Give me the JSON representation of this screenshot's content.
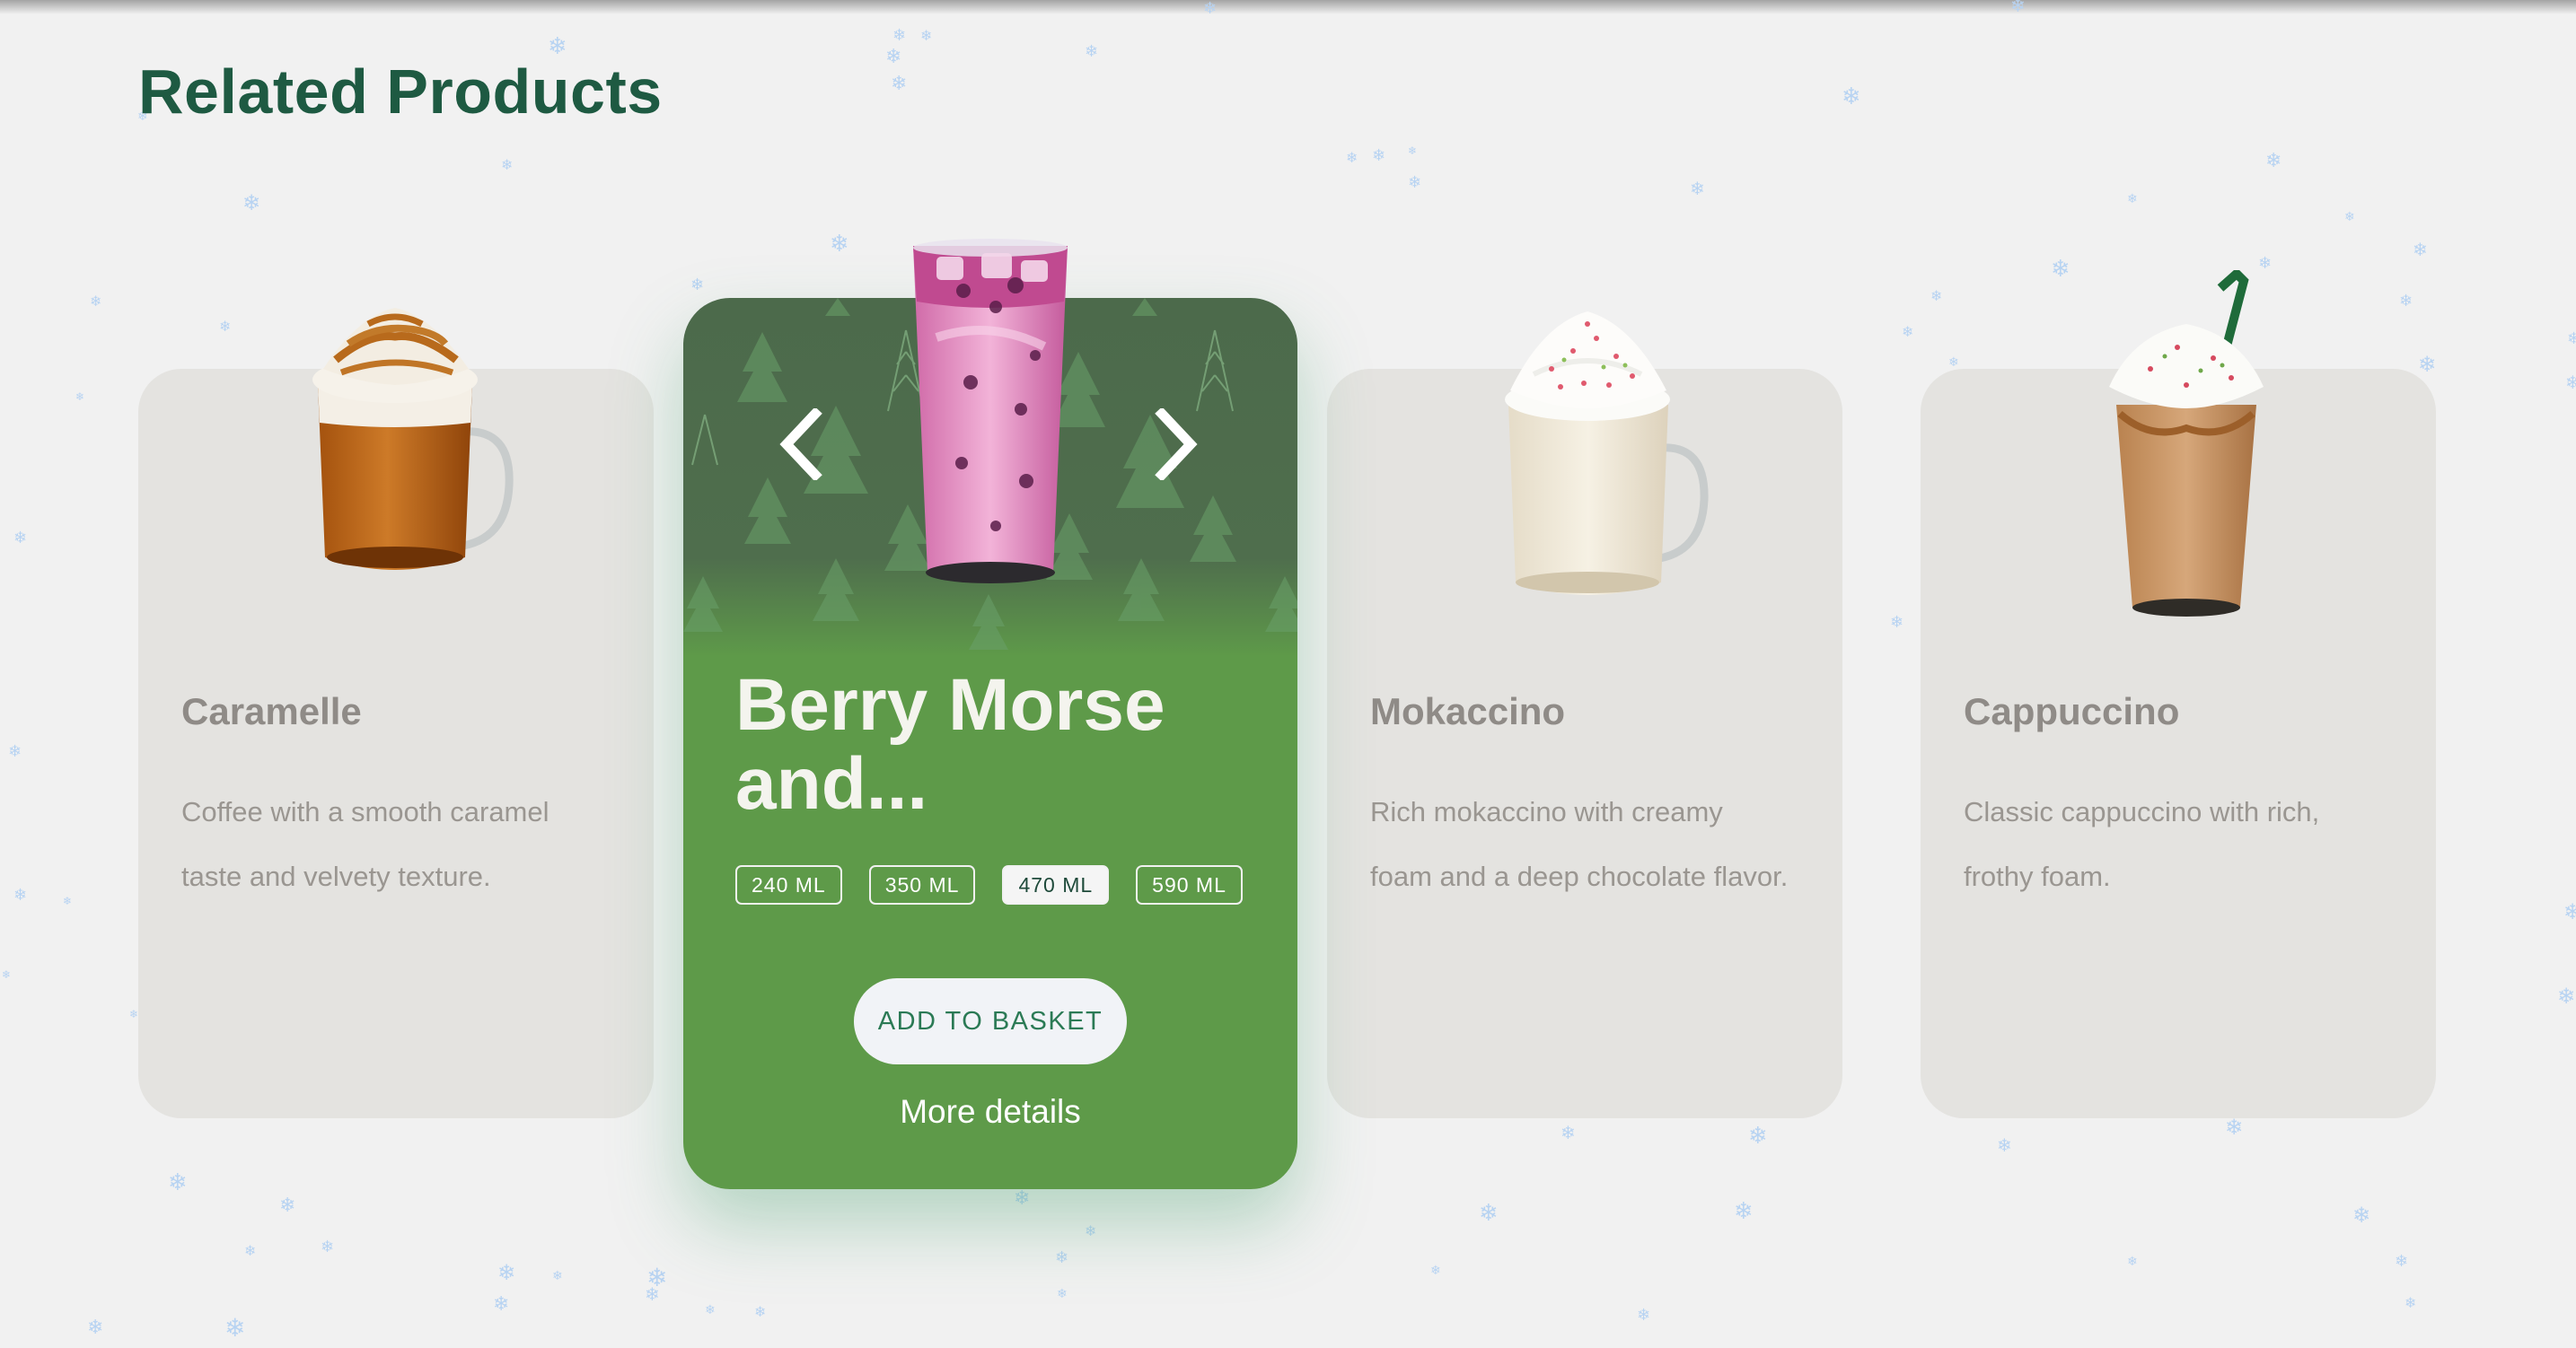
{
  "section": {
    "title": "Related Products"
  },
  "colors": {
    "title_green": "#1e5a42",
    "active_card_green": "#5e9a49",
    "active_card_dark": "#4e6d4c",
    "card_bg": "#e4e3e0",
    "button_text": "#2b7a55",
    "snow": "#b7d3f2"
  },
  "carousel": {
    "prev_icon": "chevron-left-icon",
    "next_icon": "chevron-right-icon",
    "products": [
      {
        "name": "Caramelle",
        "description": "Coffee with a smooth caramel taste and velvety texture.",
        "image": "caramel-latte-mug"
      },
      {
        "name": "Berry Morse and...",
        "image": "pink-berry-iced-drink",
        "active": true
      },
      {
        "name": "Mokaccino",
        "description": "Rich mokaccino with creamy foam and a deep chocolate flavor.",
        "image": "mokaccino-mug"
      },
      {
        "name": "Cappuccino",
        "description": "Classic cappuccino with rich, frothy foam.",
        "image": "frappuccino-cup-with-straw"
      }
    ],
    "active_product": {
      "title": "Berry Morse and...",
      "sizes": [
        "240 ML",
        "350 ML",
        "470 ML",
        "590 ML"
      ],
      "selected_size": "470 ML",
      "add_button": "ADD TO BASKET",
      "more_details": "More details"
    }
  }
}
